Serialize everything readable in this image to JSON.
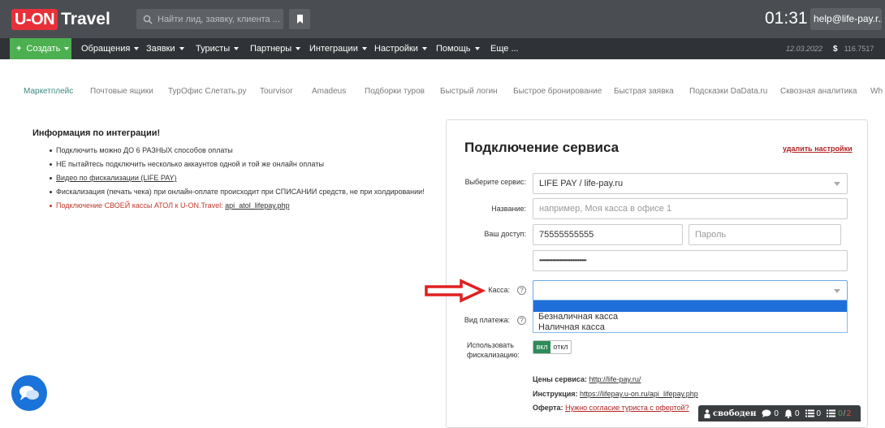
{
  "app": {
    "logo_box": "U-ON",
    "logo_text": "Travel",
    "search_placeholder": "Найти лид, заявку, клиента ...",
    "clock": "01:31",
    "user": "help@life-pay.r..."
  },
  "menu": {
    "create": "Создать",
    "items": [
      "Обращения",
      "Заявки",
      "Туристы",
      "Партнеры",
      "Интеграции",
      "Настройки",
      "Помощь",
      "Еще ..."
    ],
    "date": "12.03.2022",
    "currency": "$",
    "balance": "116.7517"
  },
  "tabs": [
    "Маркетплейс",
    "Почтовые ящики",
    "ТурОфис Слетать.ру",
    "Tourvisor",
    "Amadeus",
    "Подборки туров",
    "Быстрый логин",
    "Быстрое бронирование",
    "Быстрая заявка",
    "Подсказки DaData.ru",
    "Сквозная аналитика",
    "Wh"
  ],
  "info": {
    "title": "Информация по интеграции!",
    "item1": "Подключить можно ДО 6 РАЗНЫХ способов оплаты",
    "item2": "НЕ пытайтесь подключить несколько аккаунтов одной и той же онлайн оплаты",
    "item3": "Видео по фискализации (LIFE PAY)",
    "item4": "Фискализация (печать чека) при онлайн-оплате происходит при СПИСАНИИ средств, не при холдировании!",
    "item5_text": "Подключение СВОЕЙ кассы АТОЛ к U-ON.Travel: ",
    "item5_link": "api_atol_lifepay.php"
  },
  "form": {
    "title": "Подключение сервиса",
    "delete_link": "удалить настройки",
    "service_label": "Выберите сервис:",
    "service_value": "LIFE PAY / life-pay.ru",
    "name_label": "Название:",
    "name_placeholder": "например, Моя касса в офисе 1",
    "access_label": "Ваш доступ:",
    "login_value": "75555555555",
    "password_placeholder": "Пароль",
    "key_value": "••••••••••••••••••••••••••••••••",
    "kassa_label": "Касса:",
    "kassa_options": [
      "Безналичная касса",
      "Наличная касса"
    ],
    "payment_type_label": "Вид платежа:",
    "fiscal_label_1": "Использовать",
    "fiscal_label_2": "фискализацию:",
    "toggle_on": "вкл",
    "toggle_off": "откл",
    "prices_label": "Цены сервиса:",
    "prices_link": "http://life-pay.ru/",
    "instruction_label": "Инструкция:",
    "instruction_link": "https://lifepay.u-on.ru/api_lifepay.php",
    "offer_label": "Оферта:",
    "offer_link": "Нужно согласие туриста с офертой?"
  },
  "statusbar": {
    "status": "свободен",
    "chats": "0",
    "alerts": "0",
    "tasks": "0",
    "ratio_done": "0",
    "ratio_total": "2"
  },
  "colors": {
    "topbar": "#4a4e52",
    "menubar": "#2f3236",
    "create": "#4caf50",
    "logo": "#e8303a",
    "active_tab": "#3b8a7e",
    "arrow": "#e02020",
    "chat": "#1a73d9"
  }
}
